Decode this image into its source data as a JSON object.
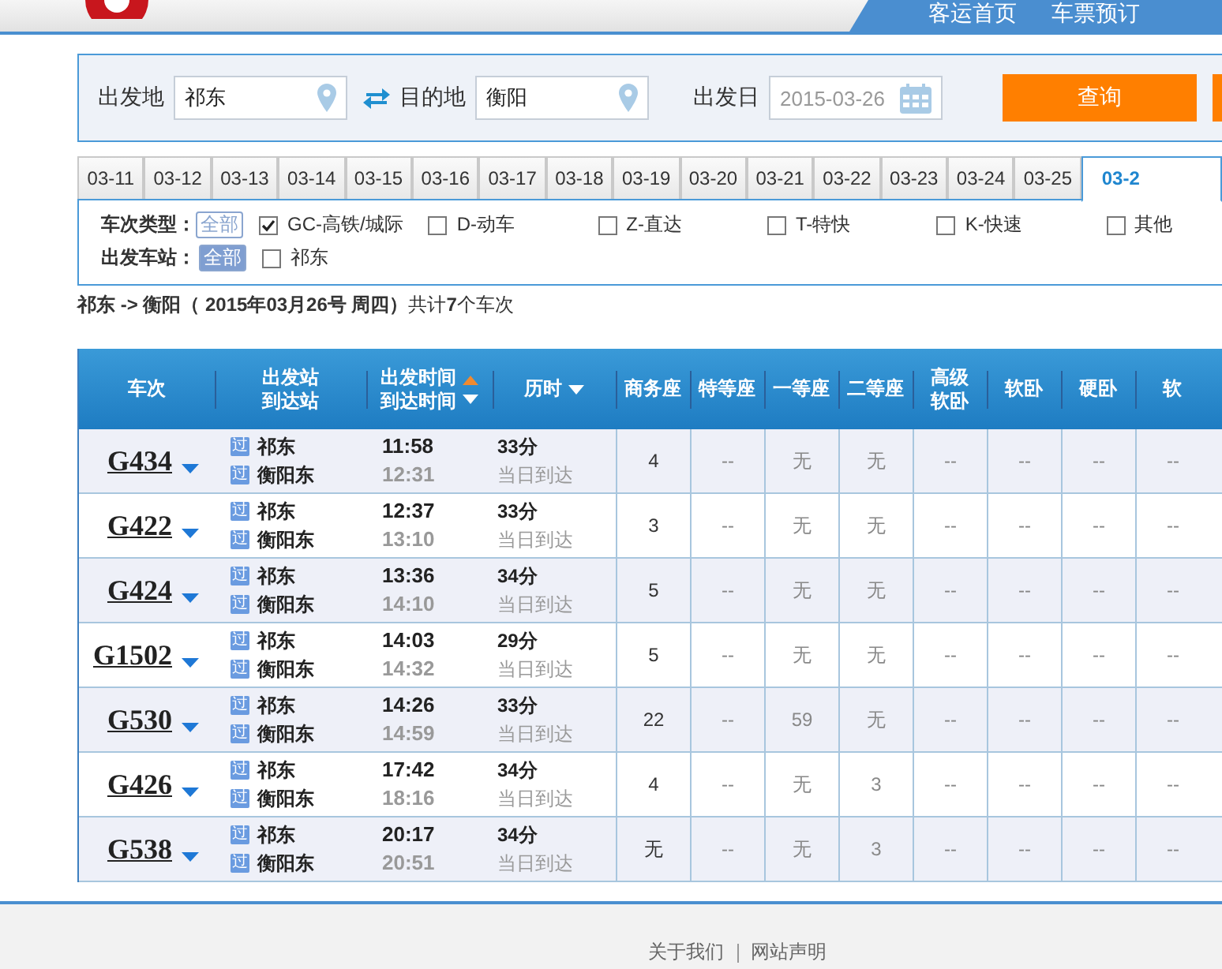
{
  "header": {
    "nav_links": [
      "客运首页",
      "车票预订"
    ]
  },
  "search": {
    "from_label": "出发地",
    "from_value": "祁东",
    "to_label": "目的地",
    "to_value": "衡阳",
    "date_label": "出发日",
    "date_value": "2015-03-26",
    "button": "查询"
  },
  "date_tabs": [
    {
      "label": "03-11",
      "selected": false
    },
    {
      "label": "03-12",
      "selected": false
    },
    {
      "label": "03-13",
      "selected": false
    },
    {
      "label": "03-14",
      "selected": false
    },
    {
      "label": "03-15",
      "selected": false
    },
    {
      "label": "03-16",
      "selected": false
    },
    {
      "label": "03-17",
      "selected": false
    },
    {
      "label": "03-18",
      "selected": false
    },
    {
      "label": "03-19",
      "selected": false
    },
    {
      "label": "03-20",
      "selected": false
    },
    {
      "label": "03-21",
      "selected": false
    },
    {
      "label": "03-22",
      "selected": false
    },
    {
      "label": "03-23",
      "selected": false
    },
    {
      "label": "03-24",
      "selected": false
    },
    {
      "label": "03-25",
      "selected": false
    },
    {
      "label": "03-2",
      "selected": true
    }
  ],
  "filters": [
    {
      "label": "车次类型：",
      "all": {
        "label": "全部",
        "selected": false
      },
      "options": [
        {
          "label": "GC-高铁/城际",
          "checked": true
        },
        {
          "label": "D-动车",
          "checked": false
        },
        {
          "label": "Z-直达",
          "checked": false
        },
        {
          "label": "T-特快",
          "checked": false
        },
        {
          "label": "K-快速",
          "checked": false
        },
        {
          "label": "其他",
          "checked": false
        }
      ]
    },
    {
      "label": "出发车站：",
      "all": {
        "label": "全部",
        "selected": true
      },
      "options": [
        {
          "label": "祁东",
          "checked": false
        }
      ]
    }
  ],
  "summary": "**祁东 -> 衡阳（ 2015年03月26号  周四）**共计**7**个车次",
  "table": {
    "columns": [
      {
        "lines": [
          "车次"
        ],
        "sort_up": false,
        "sort_down": false
      },
      {
        "lines": [
          "出发站",
          "到达站"
        ],
        "sort_up": false,
        "sort_down": false
      },
      {
        "lines": [
          "出发时间",
          "到达时间"
        ],
        "sort_up": true,
        "sort_down": true
      },
      {
        "lines": [
          "历时"
        ],
        "sort_up": false,
        "sort_down": true
      },
      {
        "lines": [
          "商务座"
        ],
        "sort_up": false,
        "sort_down": false
      },
      {
        "lines": [
          "特等座"
        ],
        "sort_up": false,
        "sort_down": false
      },
      {
        "lines": [
          "一等座"
        ],
        "sort_up": false,
        "sort_down": false
      },
      {
        "lines": [
          "二等座"
        ],
        "sort_up": false,
        "sort_down": false
      },
      {
        "lines": [
          "高级",
          "软卧"
        ],
        "sort_up": false,
        "sort_down": false
      },
      {
        "lines": [
          "软卧"
        ],
        "sort_up": false,
        "sort_down": false
      },
      {
        "lines": [
          "硬卧"
        ],
        "sort_up": false,
        "sort_down": false
      },
      {
        "lines": [
          "软"
        ],
        "sort_up": false,
        "sort_down": false
      }
    ],
    "rows": [
      {
        "train": "G434",
        "from_badge": "过",
        "from": "祁东",
        "to_badge": "过",
        "to": "衡阳东",
        "depart": "11:58",
        "arrive": "12:31",
        "duration": "33分",
        "arrival_note": "当日到达",
        "seats": [
          "4",
          "--",
          "无",
          "无",
          "--",
          "--",
          "--",
          "--"
        ]
      },
      {
        "train": "G422",
        "from_badge": "过",
        "from": "祁东",
        "to_badge": "过",
        "to": "衡阳东",
        "depart": "12:37",
        "arrive": "13:10",
        "duration": "33分",
        "arrival_note": "当日到达",
        "seats": [
          "3",
          "--",
          "无",
          "无",
          "--",
          "--",
          "--",
          "--"
        ]
      },
      {
        "train": "G424",
        "from_badge": "过",
        "from": "祁东",
        "to_badge": "过",
        "to": "衡阳东",
        "depart": "13:36",
        "arrive": "14:10",
        "duration": "34分",
        "arrival_note": "当日到达",
        "seats": [
          "5",
          "--",
          "无",
          "无",
          "--",
          "--",
          "--",
          "--"
        ]
      },
      {
        "train": "G1502",
        "from_badge": "过",
        "from": "祁东",
        "to_badge": "过",
        "to": "衡阳东",
        "depart": "14:03",
        "arrive": "14:32",
        "duration": "29分",
        "arrival_note": "当日到达",
        "seats": [
          "5",
          "--",
          "无",
          "无",
          "--",
          "--",
          "--",
          "--"
        ]
      },
      {
        "train": "G530",
        "from_badge": "过",
        "from": "祁东",
        "to_badge": "过",
        "to": "衡阳东",
        "depart": "14:26",
        "arrive": "14:59",
        "duration": "33分",
        "arrival_note": "当日到达",
        "seats": [
          "22",
          "--",
          "59",
          "无",
          "--",
          "--",
          "--",
          "--"
        ]
      },
      {
        "train": "G426",
        "from_badge": "过",
        "from": "祁东",
        "to_badge": "过",
        "to": "衡阳东",
        "depart": "17:42",
        "arrive": "18:16",
        "duration": "34分",
        "arrival_note": "当日到达",
        "seats": [
          "4",
          "--",
          "无",
          "3",
          "--",
          "--",
          "--",
          "--"
        ]
      },
      {
        "train": "G538",
        "from_badge": "过",
        "from": "祁东",
        "to_badge": "过",
        "to": "衡阳东",
        "depart": "20:17",
        "arrive": "20:51",
        "duration": "34分",
        "arrival_note": "当日到达",
        "seats": [
          "无",
          "--",
          "无",
          "3",
          "--",
          "--",
          "--",
          "--"
        ]
      }
    ]
  },
  "footer": {
    "links": [
      "关于我们",
      "网站声明"
    ]
  }
}
